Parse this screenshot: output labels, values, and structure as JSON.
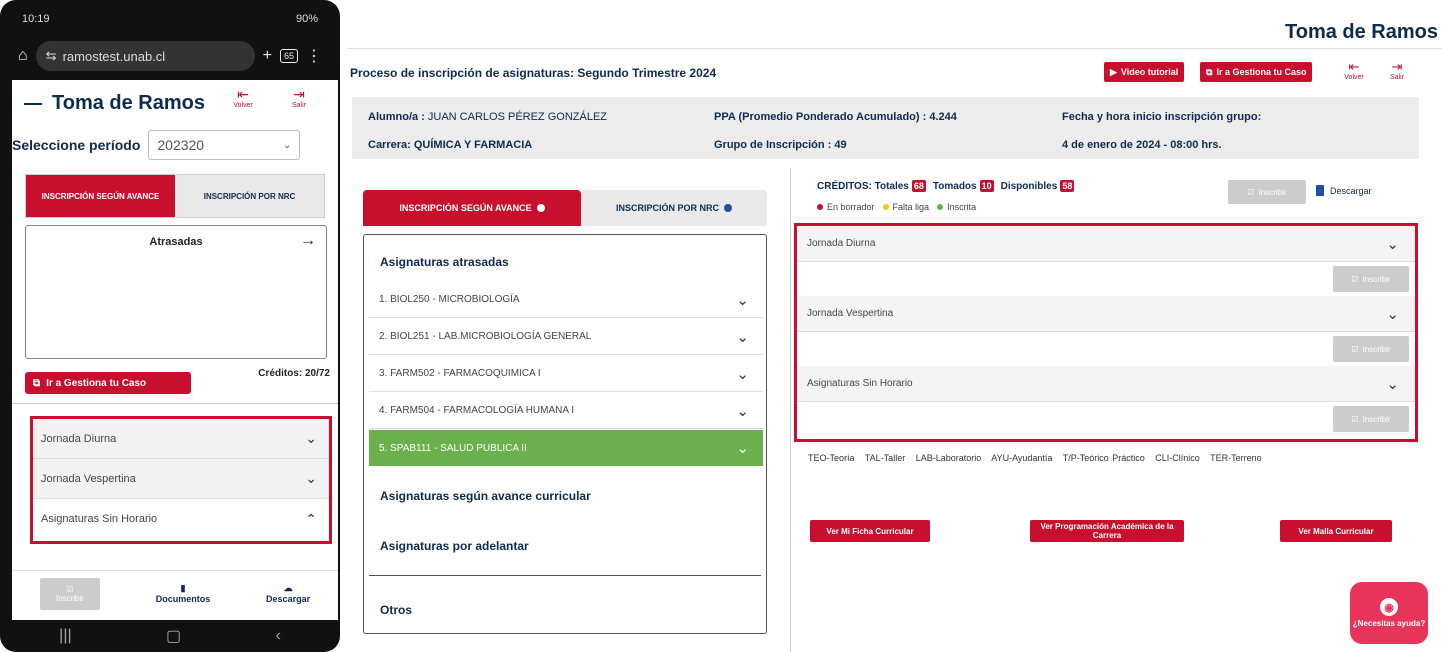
{
  "phone": {
    "status_time": "10:19",
    "status_right": "90%",
    "url": "ramostest.unab.cl",
    "tab_count": "65",
    "title": "Toma de Ramos",
    "volver": "Volver",
    "salir": "Salir",
    "period_label": "Seleccione período",
    "period_value": "202320",
    "tab_avance": "INSCRIPCIÓN SEGÚN AVANCE",
    "tab_nrc": "INSCRIPCIÓN POR NRC",
    "box_title": "Atrasadas",
    "gestiona": "Ir a Gestiona tu Caso",
    "creditos": "Créditos: 20/72",
    "jornadas": [
      "Jornada Diurna",
      "Jornada Vespertina",
      "Asignaturas Sin Horario"
    ],
    "bottom": {
      "inscribir": "Inscribir",
      "documentos": "Documentos",
      "descargar": "Descargar"
    }
  },
  "app": {
    "title": "Toma de Ramos",
    "proceso": "Proceso de inscripción de asignaturas: Segundo Trimestre 2024",
    "video": "Video tutorial",
    "gestiona": "Ir a Gestiona tu Caso",
    "volver": "Volver",
    "salir": "Salir"
  },
  "info": {
    "alumno_label": "Alumno/a :",
    "alumno": "JUAN CARLOS PÉREZ GONZÁLEZ",
    "carrera_label": "Carrera:",
    "carrera": "QUÍMICA Y FARMACIA",
    "ppa": "PPA (Promedio Ponderado Acumulado) : 4.244",
    "grupo": "Grupo de Inscripción : 49",
    "fecha_label": "Fecha y hora inicio inscripción grupo:",
    "fecha": "4 de enero de 2024 - 08:00 hrs."
  },
  "tabs": {
    "avance": "INSCRIPCIÓN SEGÚN AVANCE",
    "nrc": "INSCRIPCIÓN POR NRC"
  },
  "panel": {
    "atrasadas": "Asignaturas atrasadas",
    "courses": [
      "1. BIOL250 - MICROBIOLOGÍA",
      "2. BIOL251 - LAB.MICROBIOLOGÍA GENERAL",
      "3. FARM502 - FARMACOQUIMICA I",
      "4. FARM504 - FARMACOLOGÍA HUMANA I",
      "5. SPAB111 - SALUD PUBLICA II"
    ],
    "avance": "Asignaturas según avance curricular",
    "adelantar": "Asignaturas por adelantar",
    "otros": "Otros"
  },
  "creditos": {
    "label": "CRÉDITOS: Totales",
    "totales": "68",
    "tomados_label": "Tomados",
    "tomados": "10",
    "disponibles_label": "Disponibles",
    "disponibles": "58"
  },
  "legend": {
    "borrador": "En borrador",
    "falta": "Falta liga",
    "inscrita": "Inscrita"
  },
  "colors": {
    "borrador": "#c8102e",
    "falta": "#f5c518",
    "inscrita": "#6ab04c",
    "brand": "#c8102e",
    "navy": "#0d2a4f"
  },
  "inscribir": "Inscribir",
  "descargar": "Descargar",
  "jornadas": [
    "Jornada Diurna",
    "Jornada Vespertina",
    "Asignaturas Sin Horario"
  ],
  "abbr": "TEO-Teoría   TAL-Taller   LAB-Laboratorio   AYU-Ayudantía   T/P-Teórico Práctico   CLI-Clínico   TER-Terreno",
  "buttons": {
    "ficha": "Ver Mi Ficha Curricular",
    "programacion": "Ver Programación Académica de la Carrera",
    "malla": "Ver Malla Curricular"
  },
  "help": "¿Necesitas ayuda?"
}
